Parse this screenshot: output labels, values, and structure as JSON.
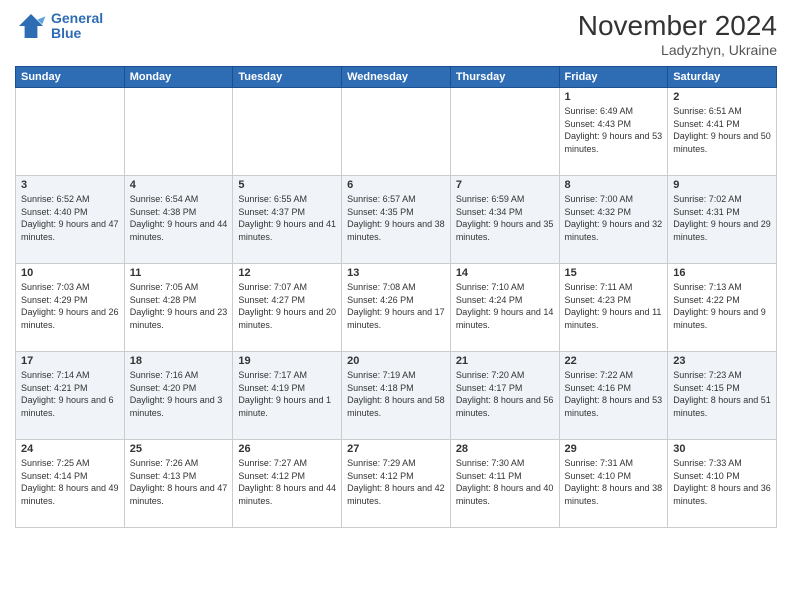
{
  "header": {
    "logo_line1": "General",
    "logo_line2": "Blue",
    "month_title": "November 2024",
    "location": "Ladyzhyn, Ukraine"
  },
  "days_of_week": [
    "Sunday",
    "Monday",
    "Tuesday",
    "Wednesday",
    "Thursday",
    "Friday",
    "Saturday"
  ],
  "weeks": [
    [
      {
        "day": "",
        "info": ""
      },
      {
        "day": "",
        "info": ""
      },
      {
        "day": "",
        "info": ""
      },
      {
        "day": "",
        "info": ""
      },
      {
        "day": "",
        "info": ""
      },
      {
        "day": "1",
        "info": "Sunrise: 6:49 AM\nSunset: 4:43 PM\nDaylight: 9 hours and 53 minutes."
      },
      {
        "day": "2",
        "info": "Sunrise: 6:51 AM\nSunset: 4:41 PM\nDaylight: 9 hours and 50 minutes."
      }
    ],
    [
      {
        "day": "3",
        "info": "Sunrise: 6:52 AM\nSunset: 4:40 PM\nDaylight: 9 hours and 47 minutes."
      },
      {
        "day": "4",
        "info": "Sunrise: 6:54 AM\nSunset: 4:38 PM\nDaylight: 9 hours and 44 minutes."
      },
      {
        "day": "5",
        "info": "Sunrise: 6:55 AM\nSunset: 4:37 PM\nDaylight: 9 hours and 41 minutes."
      },
      {
        "day": "6",
        "info": "Sunrise: 6:57 AM\nSunset: 4:35 PM\nDaylight: 9 hours and 38 minutes."
      },
      {
        "day": "7",
        "info": "Sunrise: 6:59 AM\nSunset: 4:34 PM\nDaylight: 9 hours and 35 minutes."
      },
      {
        "day": "8",
        "info": "Sunrise: 7:00 AM\nSunset: 4:32 PM\nDaylight: 9 hours and 32 minutes."
      },
      {
        "day": "9",
        "info": "Sunrise: 7:02 AM\nSunset: 4:31 PM\nDaylight: 9 hours and 29 minutes."
      }
    ],
    [
      {
        "day": "10",
        "info": "Sunrise: 7:03 AM\nSunset: 4:29 PM\nDaylight: 9 hours and 26 minutes."
      },
      {
        "day": "11",
        "info": "Sunrise: 7:05 AM\nSunset: 4:28 PM\nDaylight: 9 hours and 23 minutes."
      },
      {
        "day": "12",
        "info": "Sunrise: 7:07 AM\nSunset: 4:27 PM\nDaylight: 9 hours and 20 minutes."
      },
      {
        "day": "13",
        "info": "Sunrise: 7:08 AM\nSunset: 4:26 PM\nDaylight: 9 hours and 17 minutes."
      },
      {
        "day": "14",
        "info": "Sunrise: 7:10 AM\nSunset: 4:24 PM\nDaylight: 9 hours and 14 minutes."
      },
      {
        "day": "15",
        "info": "Sunrise: 7:11 AM\nSunset: 4:23 PM\nDaylight: 9 hours and 11 minutes."
      },
      {
        "day": "16",
        "info": "Sunrise: 7:13 AM\nSunset: 4:22 PM\nDaylight: 9 hours and 9 minutes."
      }
    ],
    [
      {
        "day": "17",
        "info": "Sunrise: 7:14 AM\nSunset: 4:21 PM\nDaylight: 9 hours and 6 minutes."
      },
      {
        "day": "18",
        "info": "Sunrise: 7:16 AM\nSunset: 4:20 PM\nDaylight: 9 hours and 3 minutes."
      },
      {
        "day": "19",
        "info": "Sunrise: 7:17 AM\nSunset: 4:19 PM\nDaylight: 9 hours and 1 minute."
      },
      {
        "day": "20",
        "info": "Sunrise: 7:19 AM\nSunset: 4:18 PM\nDaylight: 8 hours and 58 minutes."
      },
      {
        "day": "21",
        "info": "Sunrise: 7:20 AM\nSunset: 4:17 PM\nDaylight: 8 hours and 56 minutes."
      },
      {
        "day": "22",
        "info": "Sunrise: 7:22 AM\nSunset: 4:16 PM\nDaylight: 8 hours and 53 minutes."
      },
      {
        "day": "23",
        "info": "Sunrise: 7:23 AM\nSunset: 4:15 PM\nDaylight: 8 hours and 51 minutes."
      }
    ],
    [
      {
        "day": "24",
        "info": "Sunrise: 7:25 AM\nSunset: 4:14 PM\nDaylight: 8 hours and 49 minutes."
      },
      {
        "day": "25",
        "info": "Sunrise: 7:26 AM\nSunset: 4:13 PM\nDaylight: 8 hours and 47 minutes."
      },
      {
        "day": "26",
        "info": "Sunrise: 7:27 AM\nSunset: 4:12 PM\nDaylight: 8 hours and 44 minutes."
      },
      {
        "day": "27",
        "info": "Sunrise: 7:29 AM\nSunset: 4:12 PM\nDaylight: 8 hours and 42 minutes."
      },
      {
        "day": "28",
        "info": "Sunrise: 7:30 AM\nSunset: 4:11 PM\nDaylight: 8 hours and 40 minutes."
      },
      {
        "day": "29",
        "info": "Sunrise: 7:31 AM\nSunset: 4:10 PM\nDaylight: 8 hours and 38 minutes."
      },
      {
        "day": "30",
        "info": "Sunrise: 7:33 AM\nSunset: 4:10 PM\nDaylight: 8 hours and 36 minutes."
      }
    ]
  ]
}
